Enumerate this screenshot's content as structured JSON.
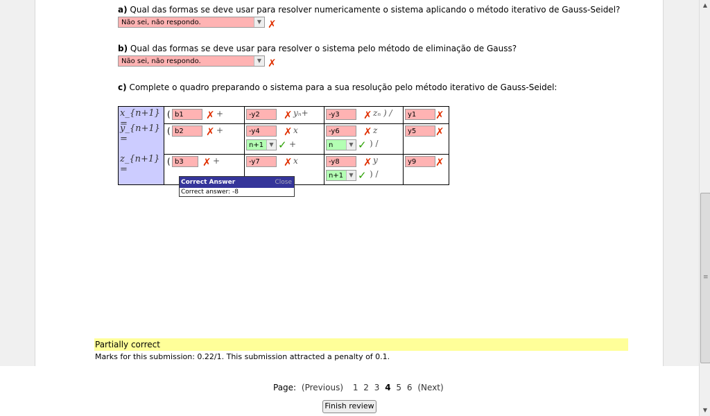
{
  "questions": {
    "a_label": "a)",
    "a_text": "Qual das formas se deve usar para resolver numericamente o sistema aplicando o método iterativo de Gauss-Seidel?",
    "a_value": "Não sei, não respondo.",
    "b_label": "b)",
    "b_text": "Qual das formas se deve usar para resolver o sistema pelo método de eliminação de Gauss?",
    "b_value": "Não sei, não respondo.",
    "c_label": "c)",
    "c_text": "Complete o quadro preparando o sistema para a sua resolução pelo método iterativo de Gauss-Seidel:"
  },
  "grid": {
    "lhs": [
      "x_{n+1} =",
      "y_{n+1} =",
      "z_{n+1} ="
    ],
    "row1": {
      "b": "b1",
      "c2": "-y2",
      "c3": "-y3",
      "c4": "y1"
    },
    "row2": {
      "b": "b2",
      "c2": "-y4",
      "c2sel": "n+1",
      "c3": "-y6",
      "c3sel": "n",
      "c4": "y5"
    },
    "row3": {
      "b": "b3",
      "c2": "-y7",
      "c3": "-y8",
      "c3sel": "n+1",
      "c4": "y9"
    }
  },
  "popup": {
    "title": "Correct Answer",
    "close": "Close",
    "body": "Correct answer: -8"
  },
  "feedback": {
    "status": "Partially correct",
    "marks": "Marks for this submission: 0.22/1. This submission attracted a penalty of 0.1."
  },
  "pager": {
    "label": "Page:",
    "previous": "(Previous)",
    "pages": [
      "1",
      "2",
      "3",
      "4",
      "5",
      "6"
    ],
    "current": "4",
    "next": "(Next)"
  },
  "finish_label": "Finish review",
  "colors": {
    "wrong": "#ffb3b3",
    "right": "#b3ffb3",
    "feedback": "#ffff99",
    "lhs": "#ccccff"
  }
}
